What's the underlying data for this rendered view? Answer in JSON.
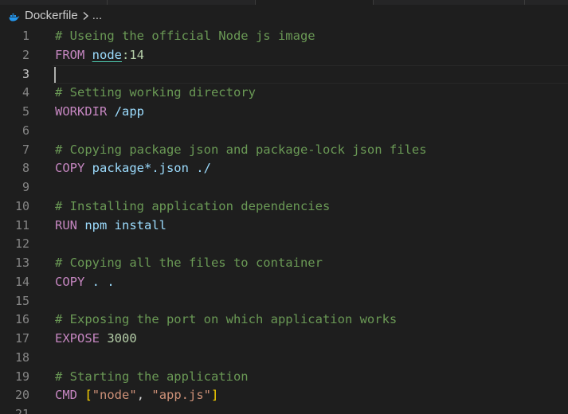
{
  "breadcrumb": {
    "file_icon": "docker-icon",
    "file": "Dockerfile",
    "separator_icon": "chevron-right-icon",
    "rest": "..."
  },
  "editor": {
    "language": "dockerfile",
    "active_line": 3,
    "lines": [
      {
        "n": "1",
        "tokens": [
          {
            "t": "# Useing the official Node js image",
            "c": "comment"
          }
        ]
      },
      {
        "n": "2",
        "tokens": [
          {
            "t": "FROM",
            "c": "keyword"
          },
          {
            "t": " ",
            "c": "plain"
          },
          {
            "t": "node",
            "c": "ident",
            "u": true
          },
          {
            "t": ":14",
            "c": "num"
          }
        ]
      },
      {
        "n": "3",
        "tokens": []
      },
      {
        "n": "4",
        "tokens": [
          {
            "t": "# Setting working directory",
            "c": "comment"
          }
        ]
      },
      {
        "n": "5",
        "tokens": [
          {
            "t": "WORKDIR",
            "c": "keyword"
          },
          {
            "t": " /app",
            "c": "ident"
          }
        ]
      },
      {
        "n": "6",
        "tokens": []
      },
      {
        "n": "7",
        "tokens": [
          {
            "t": "# Copying package json and package-lock json files",
            "c": "comment"
          }
        ]
      },
      {
        "n": "8",
        "tokens": [
          {
            "t": "COPY",
            "c": "keyword"
          },
          {
            "t": " package*.json ./",
            "c": "ident"
          }
        ]
      },
      {
        "n": "9",
        "tokens": []
      },
      {
        "n": "10",
        "tokens": [
          {
            "t": "# Installing application dependencies",
            "c": "comment"
          }
        ]
      },
      {
        "n": "11",
        "tokens": [
          {
            "t": "RUN",
            "c": "keyword"
          },
          {
            "t": " npm install",
            "c": "ident"
          }
        ]
      },
      {
        "n": "12",
        "tokens": []
      },
      {
        "n": "13",
        "tokens": [
          {
            "t": "# Copying all the files to container",
            "c": "comment"
          }
        ]
      },
      {
        "n": "14",
        "tokens": [
          {
            "t": "COPY",
            "c": "keyword"
          },
          {
            "t": " . .",
            "c": "ident"
          }
        ]
      },
      {
        "n": "15",
        "tokens": []
      },
      {
        "n": "16",
        "tokens": [
          {
            "t": "# Exposing the port on which application works",
            "c": "comment"
          }
        ]
      },
      {
        "n": "17",
        "tokens": [
          {
            "t": "EXPOSE",
            "c": "keyword"
          },
          {
            "t": " ",
            "c": "plain"
          },
          {
            "t": "3000",
            "c": "num"
          }
        ]
      },
      {
        "n": "18",
        "tokens": []
      },
      {
        "n": "19",
        "tokens": [
          {
            "t": "# Starting the application",
            "c": "comment"
          }
        ]
      },
      {
        "n": "20",
        "tokens": [
          {
            "t": "CMD",
            "c": "keyword"
          },
          {
            "t": " ",
            "c": "plain"
          },
          {
            "t": "[",
            "c": "bracket"
          },
          {
            "t": "\"node\"",
            "c": "str"
          },
          {
            "t": ", ",
            "c": "plain"
          },
          {
            "t": "\"app.js\"",
            "c": "str"
          },
          {
            "t": "]",
            "c": "bracket"
          }
        ]
      },
      {
        "n": "21",
        "tokens": []
      }
    ]
  },
  "colors": {
    "background": "#1e1e1e",
    "comment": "#6a9955",
    "keyword": "#c586c0",
    "identifier": "#9cdcfe",
    "number": "#b5cea8",
    "string": "#ce9178",
    "bracket": "#ffd700",
    "line_number": "#858585",
    "docker_icon": "#2496ed"
  }
}
